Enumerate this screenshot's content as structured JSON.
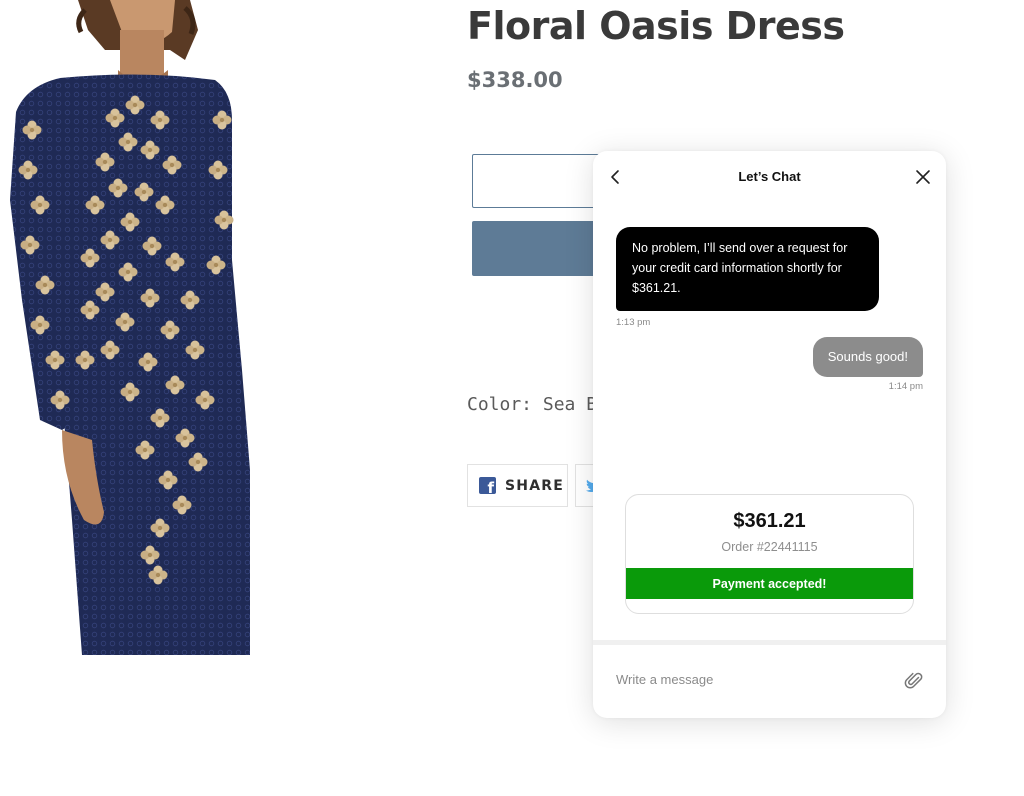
{
  "product": {
    "title": "Floral Oasis Dress",
    "price": "$338.00",
    "color_label": "Color: Sea Blue",
    "share_label": "SHARE",
    "image_icon": "dress-photo"
  },
  "colors": {
    "primary_button": "#5e7b96",
    "chat_incoming_bg": "#000000",
    "chat_outgoing_bg": "#8c8c8c",
    "payment_success": "#0a9a0a",
    "facebook": "#3b5998"
  },
  "chat": {
    "title": "Let’s Chat",
    "back_icon": "chevron-left-icon",
    "close_icon": "close-icon",
    "messages": [
      {
        "sender": "agent",
        "text": "No problem, I’ll send over a request for your credit card information shortly for $361.21.",
        "time": "1:13 pm"
      },
      {
        "sender": "user",
        "text": "Sounds good!",
        "time": "1:14 pm"
      }
    ],
    "order": {
      "amount": "$361.21",
      "order_number": "Order #22441115",
      "status": "Payment accepted!"
    },
    "input_placeholder": "Write a message",
    "attach_icon": "paperclip-icon"
  }
}
